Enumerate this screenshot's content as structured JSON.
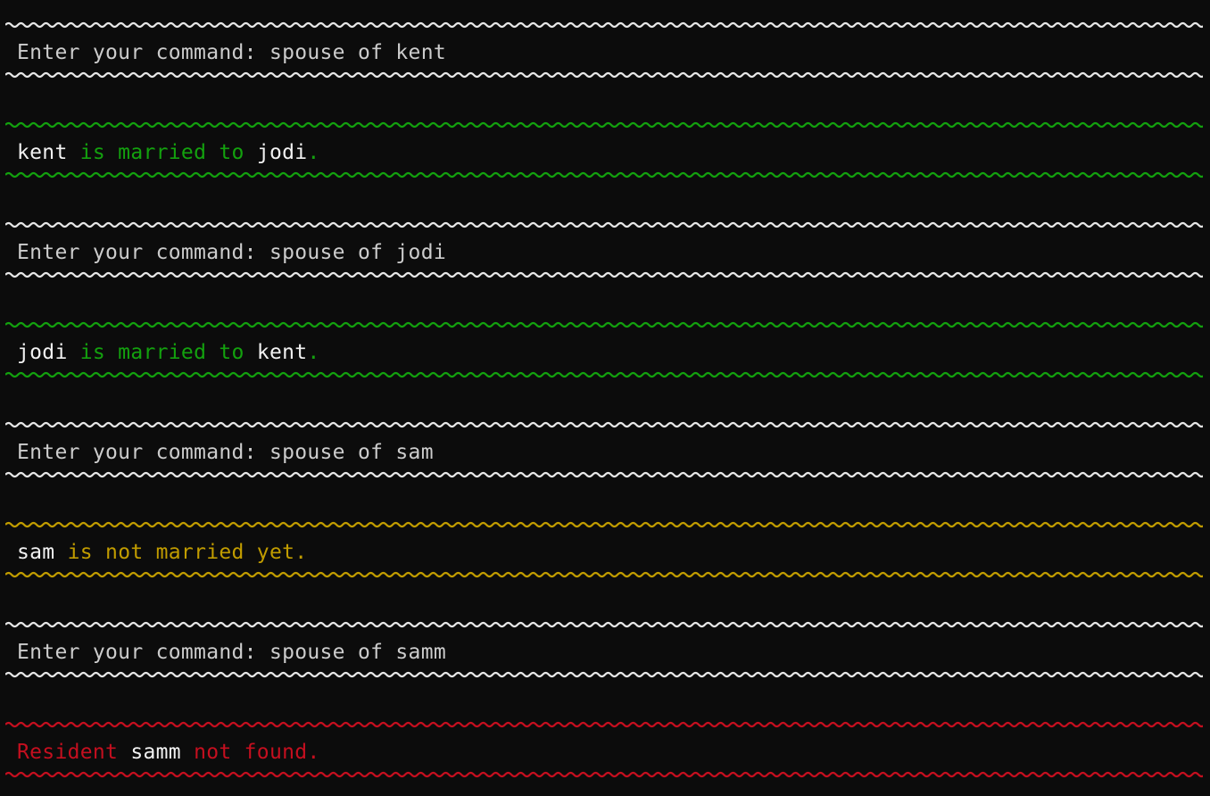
{
  "colors": {
    "background": "#0c0c0c",
    "prompt": "#cccccc",
    "rule_white": "#e6e6e6",
    "highlight": "#f2f2f2",
    "success": "#13a10e",
    "warning": "#c19c00",
    "error": "#c50f1f"
  },
  "blocks": [
    {
      "kind": "prompt",
      "text": "Enter your command: spouse of kent"
    },
    {
      "kind": "success",
      "name": "kent",
      "mid": " is married to ",
      "name2": "jodi",
      "end": "."
    },
    {
      "kind": "prompt",
      "text": "Enter your command: spouse of jodi"
    },
    {
      "kind": "success",
      "name": "jodi",
      "mid": " is married to ",
      "name2": "kent",
      "end": "."
    },
    {
      "kind": "prompt",
      "text": "Enter your command: spouse of sam"
    },
    {
      "kind": "warning",
      "name": "sam",
      "mid": " is not married yet."
    },
    {
      "kind": "prompt",
      "text": "Enter your command: spouse of samm"
    },
    {
      "kind": "error",
      "pre": "Resident ",
      "name": "samm",
      "mid": " not found."
    }
  ]
}
